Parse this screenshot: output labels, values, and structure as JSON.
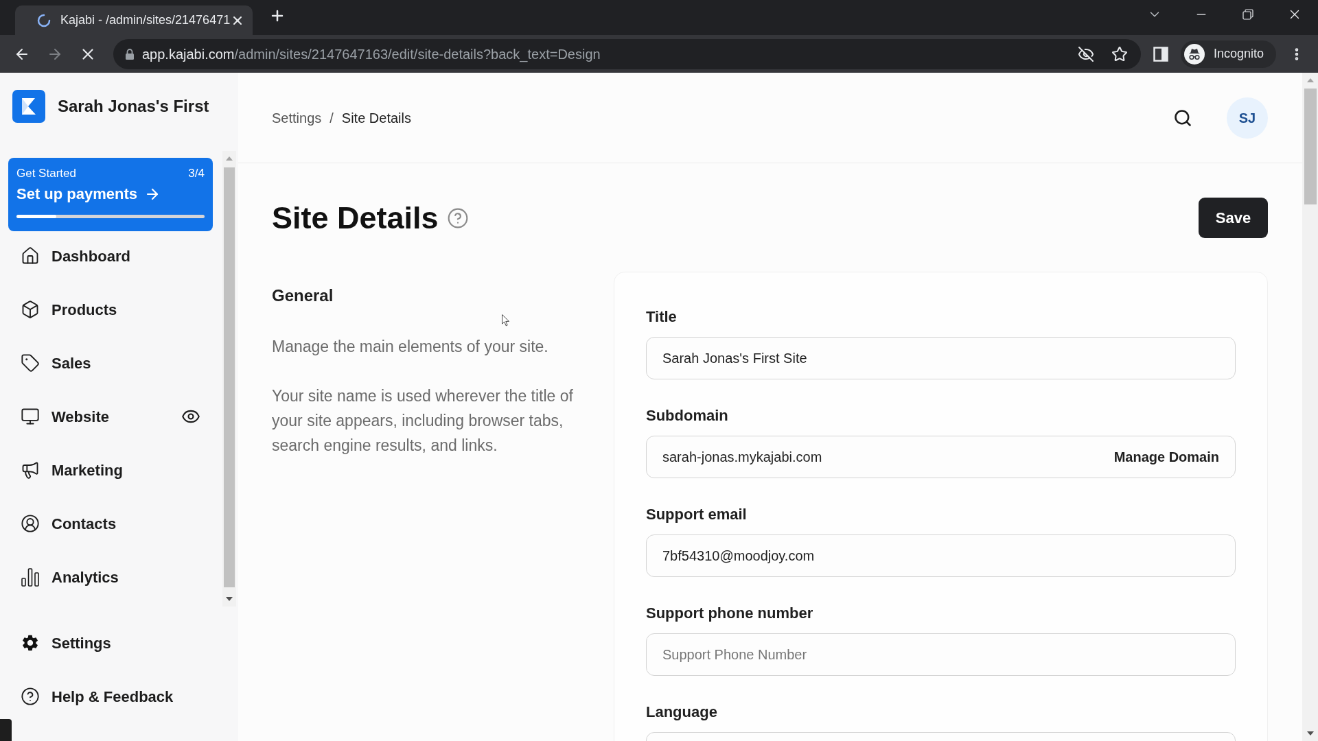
{
  "browser": {
    "tab": {
      "title": "Kajabi - /admin/sites/21476471",
      "loading": true
    },
    "url": {
      "host": "app.kajabi.com",
      "path": "/admin/sites/2147647163/edit/site-details?back_text=Design"
    },
    "forward_disabled": true,
    "profile": "Incognito"
  },
  "sidebar": {
    "site_name": "Sarah Jonas's First",
    "get_started": {
      "label": "Get Started",
      "count": "3/4",
      "action": "Set up payments",
      "level": 0.21
    },
    "nav": [
      {
        "label": "Dashboard"
      },
      {
        "label": "Products"
      },
      {
        "label": "Sales"
      },
      {
        "label": "Website"
      },
      {
        "label": "Marketing"
      },
      {
        "label": "Contacts"
      },
      {
        "label": "Analytics"
      }
    ],
    "footer": [
      {
        "label": "Settings"
      },
      {
        "label": "Help & Feedback"
      }
    ]
  },
  "header": {
    "breadcrumb": [
      {
        "label": "Settings"
      },
      {
        "label": "Site Details"
      }
    ],
    "separator": "/",
    "avatar": "SJ"
  },
  "page": {
    "title": "Site Details",
    "save": "Save"
  },
  "section": {
    "title": "General",
    "paragraphs": [
      "Manage the main elements of your site.",
      "Your site name is used wherever the title of your site appears, including browser tabs, search engine results, and links."
    ],
    "fields": [
      {
        "label": "Title",
        "kind": "text",
        "value": "Sarah Jonas's First Site"
      },
      {
        "label": "Subdomain",
        "kind": "text",
        "value": "sarah-jonas.mykajabi.com",
        "action": "Manage Domain"
      },
      {
        "label": "Support email",
        "kind": "text",
        "value": "7bf54310@moodjoy.com"
      },
      {
        "label": "Support phone number",
        "kind": "text",
        "placeholder": "Support Phone Number"
      },
      {
        "label": "Language",
        "kind": "select"
      }
    ]
  }
}
